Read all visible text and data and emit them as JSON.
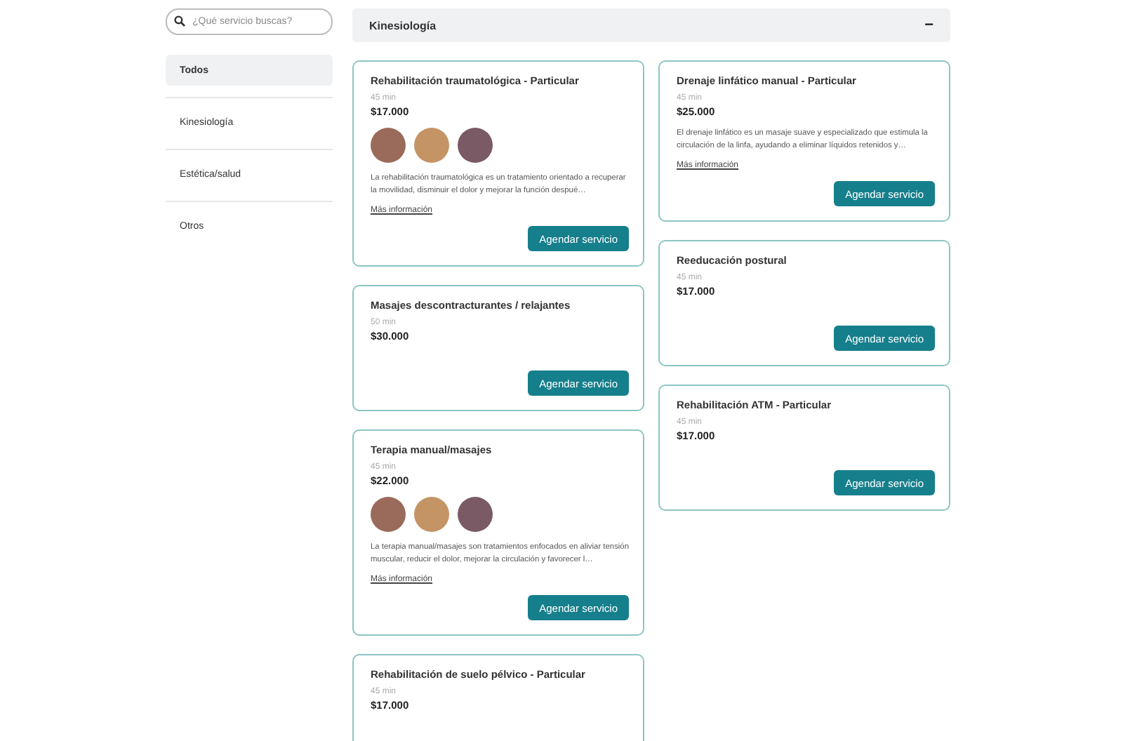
{
  "search": {
    "placeholder": "¿Qué servicio buscas?"
  },
  "categories": [
    {
      "label": "Todos",
      "selected": true
    },
    {
      "label": "Kinesiología",
      "selected": false
    },
    {
      "label": "Estética/salud",
      "selected": false
    },
    {
      "label": "Otros",
      "selected": false
    }
  ],
  "section": {
    "title": "Kinesiología",
    "toggle": "−"
  },
  "columns": [
    [
      {
        "title": "Rehabilitación traumatológica - Particular",
        "duration": "45 min",
        "price": "$17.000",
        "has_photos": true,
        "description": "La rehabilitación traumatológica es un tratamiento orientado a recuperar la movilidad, disminuir el dolor y mejorar la función despué…",
        "link": "Más información",
        "button": "Agendar servicio"
      },
      {
        "title": "Masajes descontracturantes / relajantes",
        "duration": "50 min",
        "price": "$30.000",
        "button": "Agendar servicio"
      },
      {
        "title": "Terapia manual/masajes",
        "duration": "45 min",
        "price": "$22.000",
        "has_photos": true,
        "description": "La terapia manual/masajes son tratamientos enfocados en aliviar tensión muscular, reducir el dolor, mejorar la circulación y favorecer l…",
        "link": "Más información",
        "button": "Agendar servicio"
      },
      {
        "title": "Rehabilitación de suelo pélvico - Particular",
        "duration": "45 min",
        "price": "$17.000"
      }
    ],
    [
      {
        "title": "Drenaje linfático manual - Particular",
        "duration": "45 min",
        "price": "$25.000",
        "description": "El drenaje linfático es un masaje suave y especializado que estimula la circulación de la linfa, ayudando a eliminar líquidos retenidos y…",
        "link": "Más información",
        "button": "Agendar servicio"
      },
      {
        "title": "Reeducación postural",
        "duration": "45 min",
        "price": "$17.000",
        "button": "Agendar servicio"
      },
      {
        "title": "Rehabilitación ATM - Particular",
        "duration": "45 min",
        "price": "$17.000",
        "button": "Agendar servicio"
      }
    ]
  ]
}
